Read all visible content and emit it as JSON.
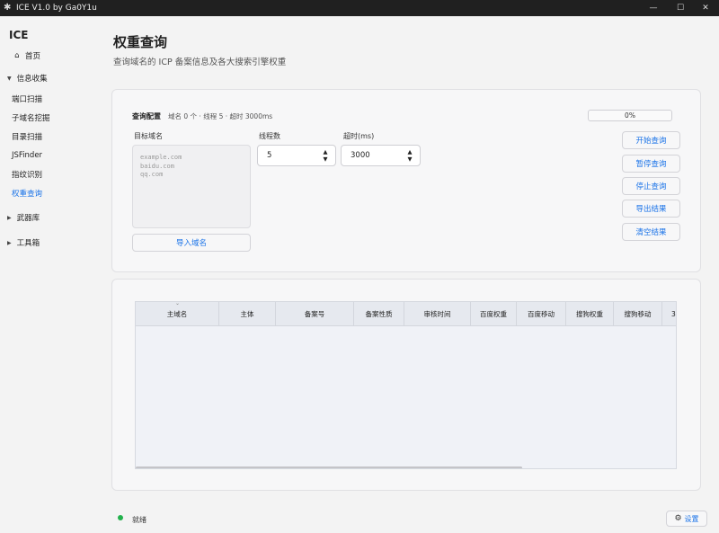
{
  "window": {
    "title": "ICE V1.0 by Ga0Y1u"
  },
  "sidebar": {
    "brand": "ICE",
    "home": "首页",
    "groups": [
      {
        "label": "信息收集",
        "expanded": true,
        "items": [
          "端口扫描",
          "子域名挖掘",
          "目录扫描",
          "JSFinder",
          "指纹识别",
          "权重查询"
        ]
      },
      {
        "label": "武器库",
        "expanded": false
      },
      {
        "label": "工具箱",
        "expanded": false
      }
    ]
  },
  "page": {
    "title": "权重查询",
    "subtitle": "查询域名的 ICP 备案信息及各大搜索引擎权重"
  },
  "config": {
    "title": "查询配置",
    "meta": "域名 0 个 · 线程 5 · 超时 3000ms",
    "progress": "0%",
    "progress_value": 0,
    "target_label": "目标域名",
    "target_placeholder": "example.com\nbaidu.com\nqq.com",
    "threads_label": "线程数",
    "threads_value": "5",
    "timeout_label": "超时(ms)",
    "timeout_value": "3000",
    "import_button": "导入域名",
    "actions": [
      "开始查询",
      "暂停查询",
      "停止查询",
      "导出结果",
      "清空结果"
    ]
  },
  "table": {
    "columns": [
      "主域名",
      "主体",
      "备案号",
      "备案性质",
      "审核时间",
      "百度权重",
      "百度移动",
      "搜狗权重",
      "搜狗移动",
      "3"
    ]
  },
  "status": {
    "text": "就绪",
    "color": "#22b14c"
  },
  "settings_button": "设置"
}
